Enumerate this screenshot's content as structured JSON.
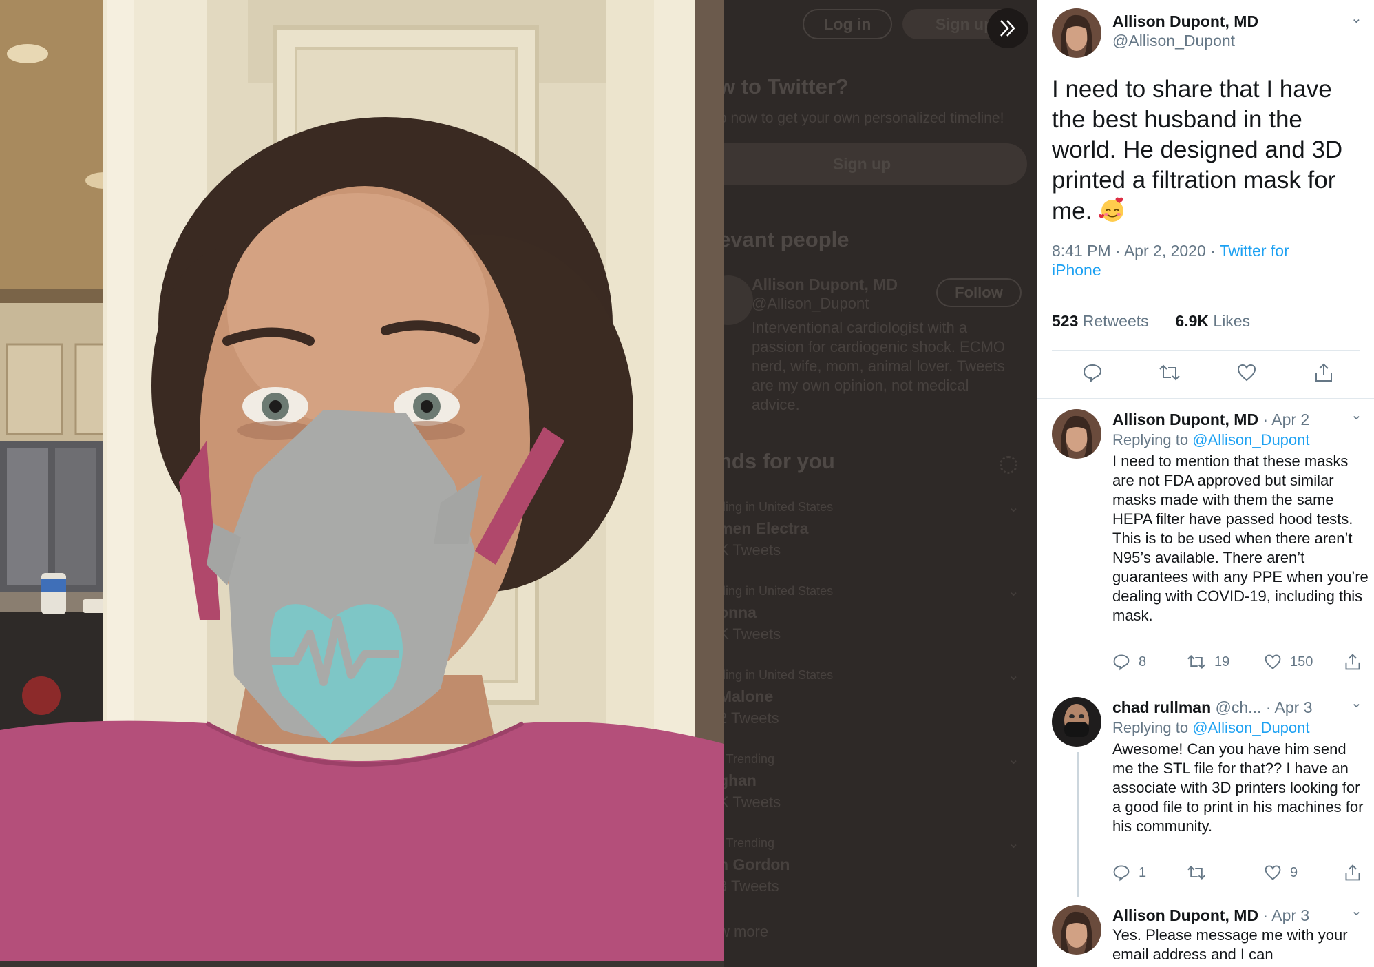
{
  "background_page": {
    "login_label": "Log in",
    "signup_label": "Sign up",
    "new_heading": "w to Twitter?",
    "new_sub": "p now to get your own personalized timeline!",
    "signup_big": "Sign up",
    "relevant_heading": "evant people",
    "person_name": "Allison Dupont, MD",
    "person_handle": "@Allison_Dupont",
    "follow_label": "Follow",
    "person_bio": "Interventional cardiologist with a passion for cardiogenic shock. ECMO nerd, wife, mom, animal lover. Tweets are my own opinion, not medical advice.",
    "trends_heading": "nds for you",
    "trends": [
      {
        "context": "ding in United States",
        "name": "men Electra",
        "count": "K Tweets"
      },
      {
        "context": "ding in United States",
        "name": "onna",
        "count": "K Tweets"
      },
      {
        "context": "ding in United States",
        "name": " Malone",
        "count": "2 Tweets"
      },
      {
        "context": "· Trending",
        "name": "ghan",
        "count": "K Tweets"
      },
      {
        "context": "· Trending",
        "name": "n Gordon",
        "count": "3 Tweets"
      }
    ],
    "show_more": "w more"
  },
  "tweet": {
    "author_name": "Allison Dupont, MD",
    "author_handle": "@Allison_Dupont",
    "text": "I need to share that I have the best husband in the world. He designed and 3D printed a filtration mask for me.",
    "emoji": "smiling-face-with-hearts",
    "time": "8:41 PM · Apr 2, 2020 · ",
    "source": "Twitter for iPhone",
    "retweets_count": "523",
    "retweets_label": "Retweets",
    "likes_count": "6.9K",
    "likes_label": "Likes"
  },
  "replies": [
    {
      "name": "Allison Dupont, MD",
      "handle_suffix": " · Apr 2",
      "replying_prefix": "Replying to ",
      "replying_to": "@Allison_Dupont",
      "text": "I need to mention that these masks are not FDA approved but similar masks made with them the same HEPA filter have passed hood tests. This is to be used when there aren’t N95’s available. There aren’t guarantees with any PPE when you’re dealing with COVID-19, including this mask.",
      "reply_count": "8",
      "retweet_count": "19",
      "like_count": "150"
    },
    {
      "name": "chad rullman",
      "handle_suffix": " @ch...  · Apr 3",
      "replying_prefix": "Replying to ",
      "replying_to": "@Allison_Dupont",
      "text": "Awesome! Can you have him send me the STL file for that?? I have an associate with 3D printers looking for a good file to print in his machines for his community.",
      "reply_count": "1",
      "retweet_count": "",
      "like_count": "9"
    },
    {
      "name": "Allison Dupont, MD",
      "handle_suffix": " · Apr 3",
      "text": "Yes. Please message me with your email address and I can"
    }
  ],
  "colors": {
    "accent": "#1da1f2",
    "text_primary": "#14171a",
    "text_secondary": "#657786",
    "dim_overlay": "#2e2927"
  }
}
